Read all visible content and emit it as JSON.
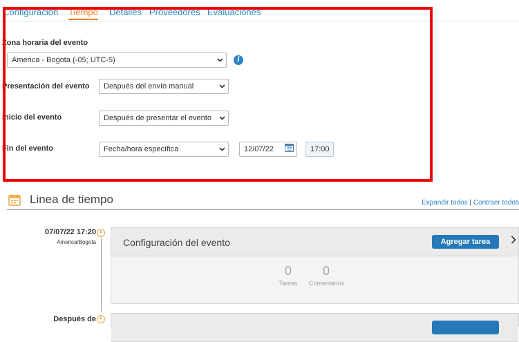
{
  "tabs": [
    {
      "label": "Configuración",
      "active": false
    },
    {
      "label": "Tiempo",
      "active": true
    },
    {
      "label": "Detalles",
      "active": false
    },
    {
      "label": "Proveedores",
      "active": false
    },
    {
      "label": "Evaluaciones",
      "active": false
    }
  ],
  "form": {
    "timezone_label": "Zona horaria del evento",
    "timezone_value": "America - Bogota (-05; UTC-5)",
    "presentation_label": "Presentación del evento",
    "presentation_value": "Después del envío manual",
    "start_label": "Inicio del evento",
    "start_value": "Después de presentar el evento",
    "end_label": "Fin del evento",
    "end_value": "Fecha/hora específica",
    "end_date": "12/07/22",
    "end_time": "17:00"
  },
  "timeline": {
    "title": "Linea de tiempo",
    "expand_all": "Expandir todos",
    "separator": "|",
    "collapse_all": "Contraer todos",
    "entries": [
      {
        "date": "07/07/22 17:20",
        "zone": "America/Bogota",
        "card_title": "Configuración del evento",
        "add_task_label": "Agregar tarea",
        "tasks_count": "0",
        "tasks_label": "Tareas",
        "comments_count": "0",
        "comments_label": "Comentarios"
      },
      {
        "date": "Después de"
      }
    ]
  },
  "colors": {
    "accent_blue": "#2a84c6",
    "active_tab": "#f47d20",
    "highlight_red": "#ee0000",
    "button_blue": "#2679b8",
    "clock_orange": "#e8a33a"
  }
}
